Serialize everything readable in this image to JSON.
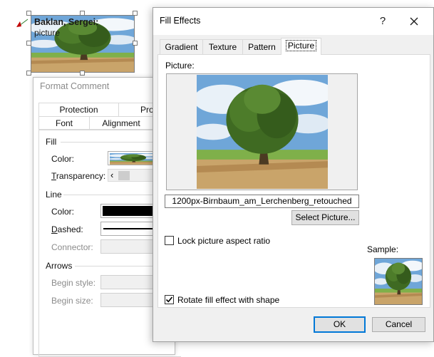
{
  "comment": {
    "author": "Baklan, Sergei:",
    "text": "picture"
  },
  "format_comment": {
    "title": "Format Comment",
    "tabs_row1": [
      "Protection",
      "Prop"
    ],
    "tabs_row2": [
      "Font",
      "Alignment"
    ],
    "fill_group": "Fill",
    "color_label": "Color:",
    "transparency_label": "Transparency:",
    "line_group": "Line",
    "line_color_label": "Color:",
    "dashed_label": "Dashed:",
    "connector_label": "Connector:",
    "arrows_group": "Arrows",
    "begin_style_label": "Begin style:",
    "begin_size_label": "Begin size:",
    "scroll_left": "‹"
  },
  "fill_effects": {
    "title": "Fill Effects",
    "help": "?",
    "close": "✕",
    "tabs": [
      "Gradient",
      "Texture",
      "Pattern",
      "Picture"
    ],
    "selected_tab": "Picture",
    "picture_label": "Picture:",
    "picture_name": "1200px-Birnbaum_am_Lerchenberg_retouched",
    "select_picture_button": "Select Picture...",
    "lock_aspect_label": "Lock picture aspect ratio",
    "lock_aspect_checked": false,
    "rotate_label": "Rotate fill effect with shape",
    "rotate_checked": true,
    "sample_label": "Sample:",
    "ok_button": "OK",
    "cancel_button": "Cancel",
    "accent_color": "#0078d7"
  }
}
